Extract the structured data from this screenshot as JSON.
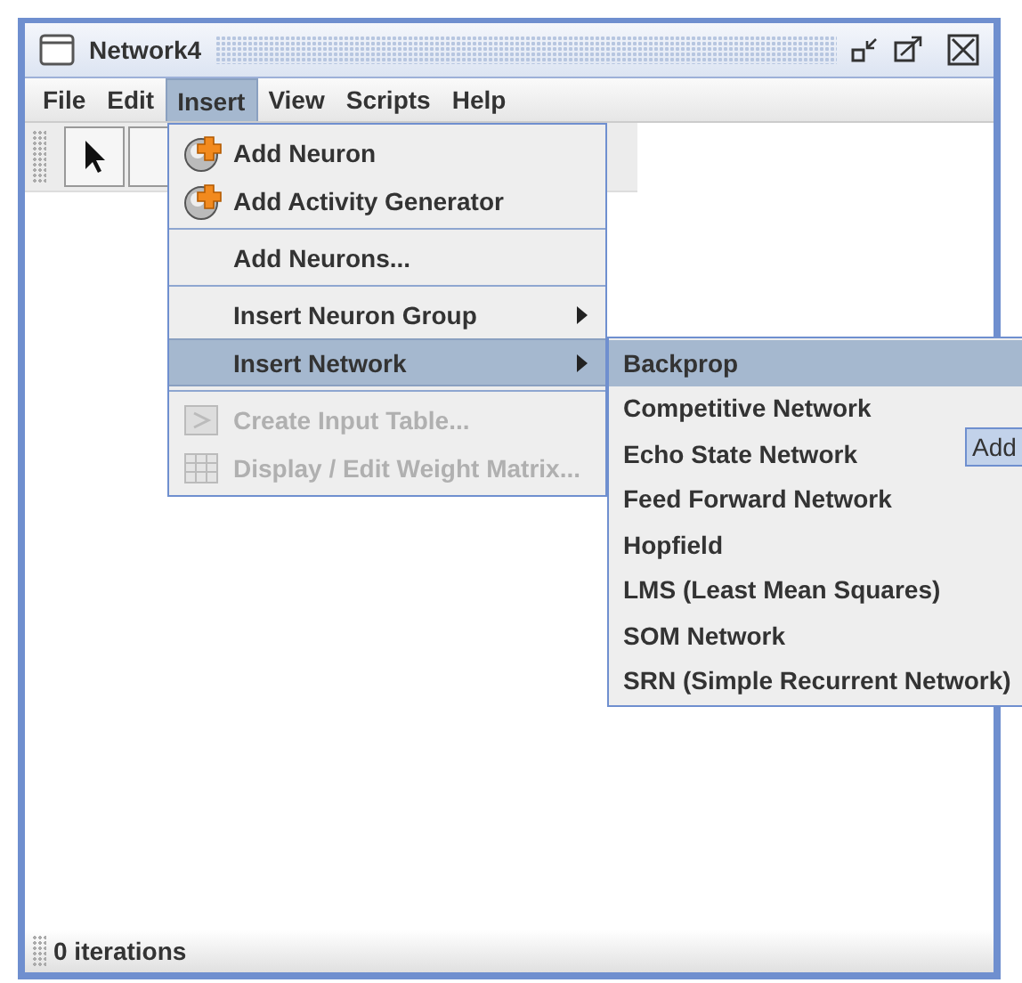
{
  "window": {
    "title": "Network4"
  },
  "menu_bar": [
    {
      "label": "File",
      "selected": false
    },
    {
      "label": "Edit",
      "selected": false
    },
    {
      "label": "Insert",
      "selected": true
    },
    {
      "label": "View",
      "selected": false
    },
    {
      "label": "Scripts",
      "selected": false
    },
    {
      "label": "Help",
      "selected": false
    }
  ],
  "insert_menu": {
    "items": [
      {
        "kind": "add",
        "label": "Add Neuron",
        "disabled": false,
        "selected": false
      },
      {
        "kind": "add",
        "label": "Add Activity Generator",
        "disabled": false,
        "selected": false
      },
      {
        "kind": "separator"
      },
      {
        "kind": "plain",
        "label": "Add Neurons...",
        "disabled": false,
        "selected": false
      },
      {
        "kind": "separator"
      },
      {
        "kind": "submenu",
        "label": "Insert Neuron Group",
        "disabled": false,
        "selected": false
      },
      {
        "kind": "submenu",
        "label": "Insert Network",
        "disabled": false,
        "selected": true
      },
      {
        "kind": "separator"
      },
      {
        "kind": "table",
        "label": "Create Input Table...",
        "disabled": true,
        "selected": false
      },
      {
        "kind": "grid",
        "label": "Display / Edit Weight Matrix...",
        "disabled": true,
        "selected": false
      }
    ]
  },
  "network_submenu": {
    "items": [
      {
        "label": "Backprop",
        "selected": true
      },
      {
        "label": "Competitive Network",
        "selected": false
      },
      {
        "label": "Echo State Network",
        "selected": false
      },
      {
        "label": "Feed Forward Network",
        "selected": false
      },
      {
        "label": "Hopfield",
        "selected": false
      },
      {
        "label": "LMS (Least Mean Squares)",
        "selected": false
      },
      {
        "label": "SOM Network",
        "selected": false
      },
      {
        "label": "SRN (Simple Recurrent Network)",
        "selected": false
      }
    ]
  },
  "canvas": {
    "button": "Add"
  },
  "status_bar": "0 iterations"
}
